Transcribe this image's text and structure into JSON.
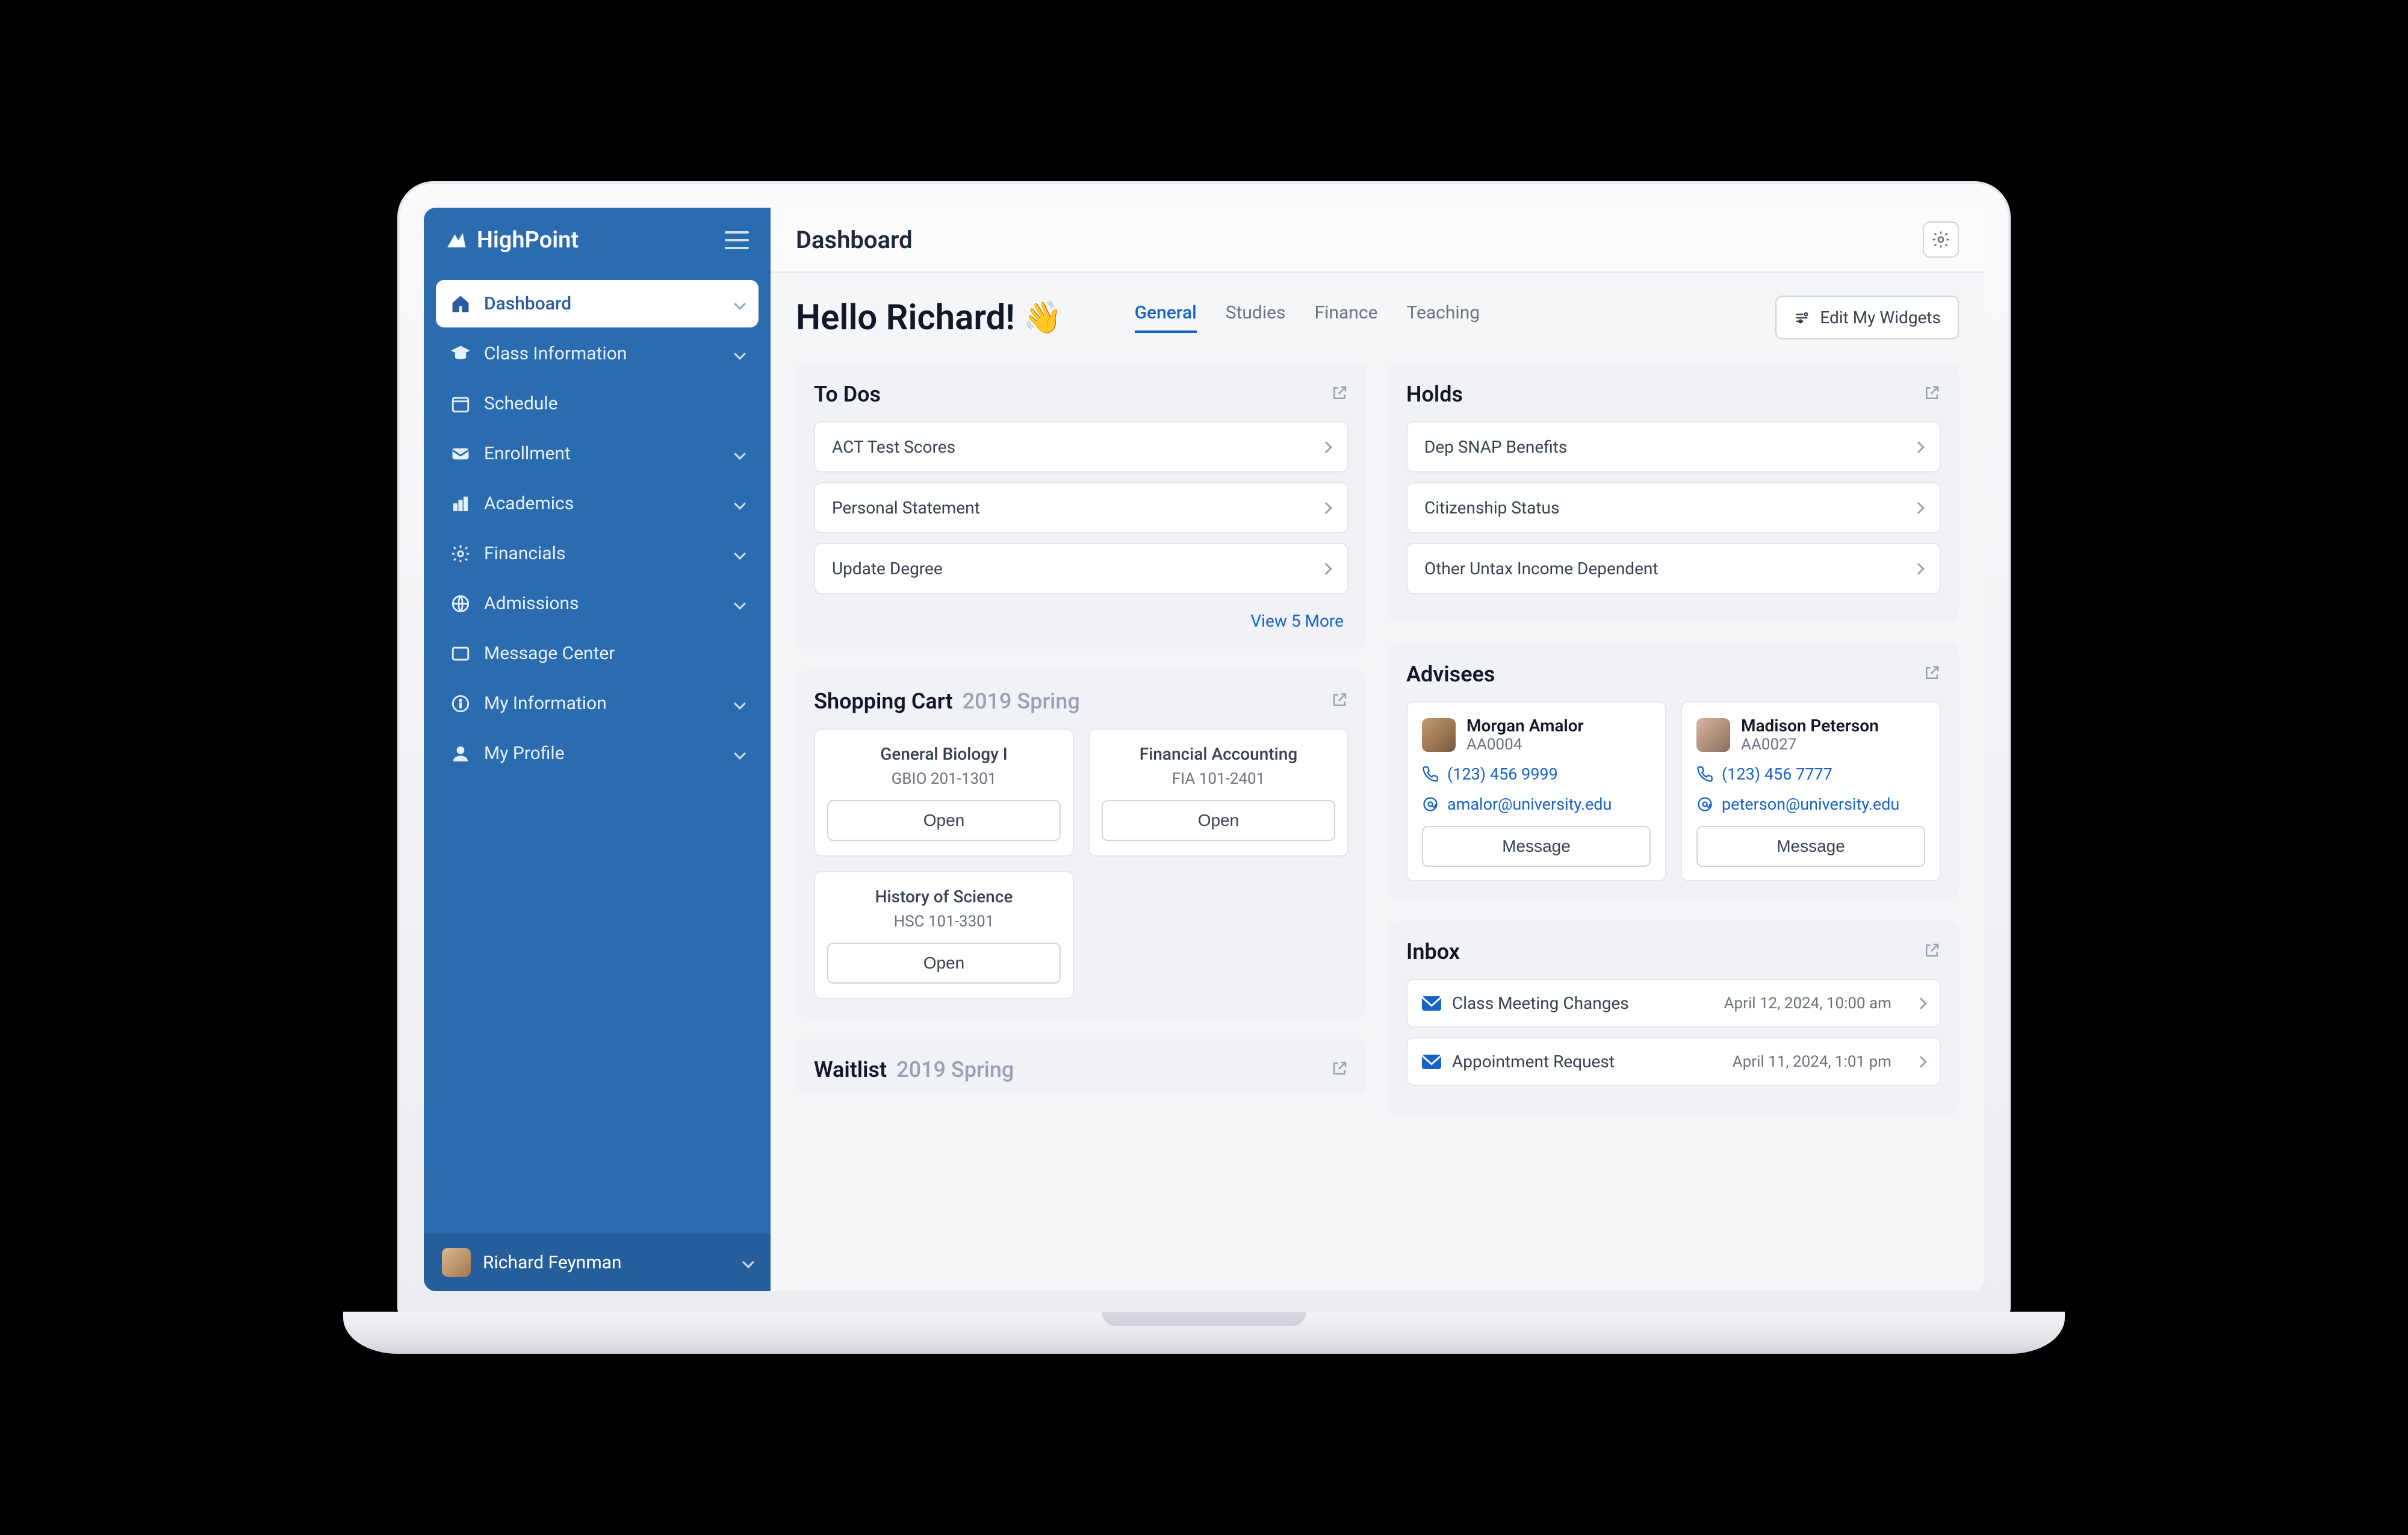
{
  "brand": "HighPoint",
  "sidebar": {
    "items": [
      {
        "label": "Dashboard",
        "icon": "home",
        "active": true,
        "expandable": true
      },
      {
        "label": "Class Information",
        "icon": "grad-cap",
        "expandable": true
      },
      {
        "label": "Schedule",
        "icon": "calendar",
        "expandable": false
      },
      {
        "label": "Enrollment",
        "icon": "inbox",
        "expandable": true
      },
      {
        "label": "Academics",
        "icon": "chart",
        "expandable": true
      },
      {
        "label": "Financials",
        "icon": "gear",
        "expandable": true
      },
      {
        "label": "Admissions",
        "icon": "globe",
        "expandable": true
      },
      {
        "label": "Message Center",
        "icon": "message",
        "expandable": false
      },
      {
        "label": "My Information",
        "icon": "info",
        "expandable": true
      },
      {
        "label": "My Profile",
        "icon": "profile",
        "expandable": true
      }
    ],
    "user": "Richard Feynman"
  },
  "header": {
    "title": "Dashboard"
  },
  "greeting": "Hello Richard!",
  "tabs": [
    "General",
    "Studies",
    "Finance",
    "Teaching"
  ],
  "active_tab": "General",
  "edit_widgets_label": "Edit My Widgets",
  "todos": {
    "title": "To Dos",
    "items": [
      "ACT Test Scores",
      "Personal Statement",
      "Update Degree"
    ],
    "view_more": "View 5 More"
  },
  "holds": {
    "title": "Holds",
    "items": [
      "Dep SNAP Benefits",
      "Citizenship Status",
      "Other Untax Income Dependent"
    ]
  },
  "cart": {
    "title": "Shopping Cart",
    "term": "2019 Spring",
    "open_label": "Open",
    "items": [
      {
        "title": "General Biology I",
        "code": "GBIO 201-1301"
      },
      {
        "title": "Financial Accounting",
        "code": "FIA 101-2401"
      },
      {
        "title": "History of Science",
        "code": "HSC 101-3301"
      }
    ]
  },
  "waitlist": {
    "title": "Waitlist",
    "term": "2019 Spring"
  },
  "advisees": {
    "title": "Advisees",
    "msg_label": "Message",
    "list": [
      {
        "name": "Morgan Amalor",
        "id": "AA0004",
        "phone": "(123) 456 9999",
        "email": "amalor@university.edu"
      },
      {
        "name": "Madison Peterson",
        "id": "AA0027",
        "phone": "(123) 456 7777",
        "email": "peterson@university.edu"
      }
    ]
  },
  "inbox": {
    "title": "Inbox",
    "items": [
      {
        "subject": "Class Meeting Changes",
        "ts": "April 12, 2024, 10:00 am"
      },
      {
        "subject": "Appointment Request",
        "ts": "April 11, 2024, 1:01 pm"
      }
    ]
  }
}
